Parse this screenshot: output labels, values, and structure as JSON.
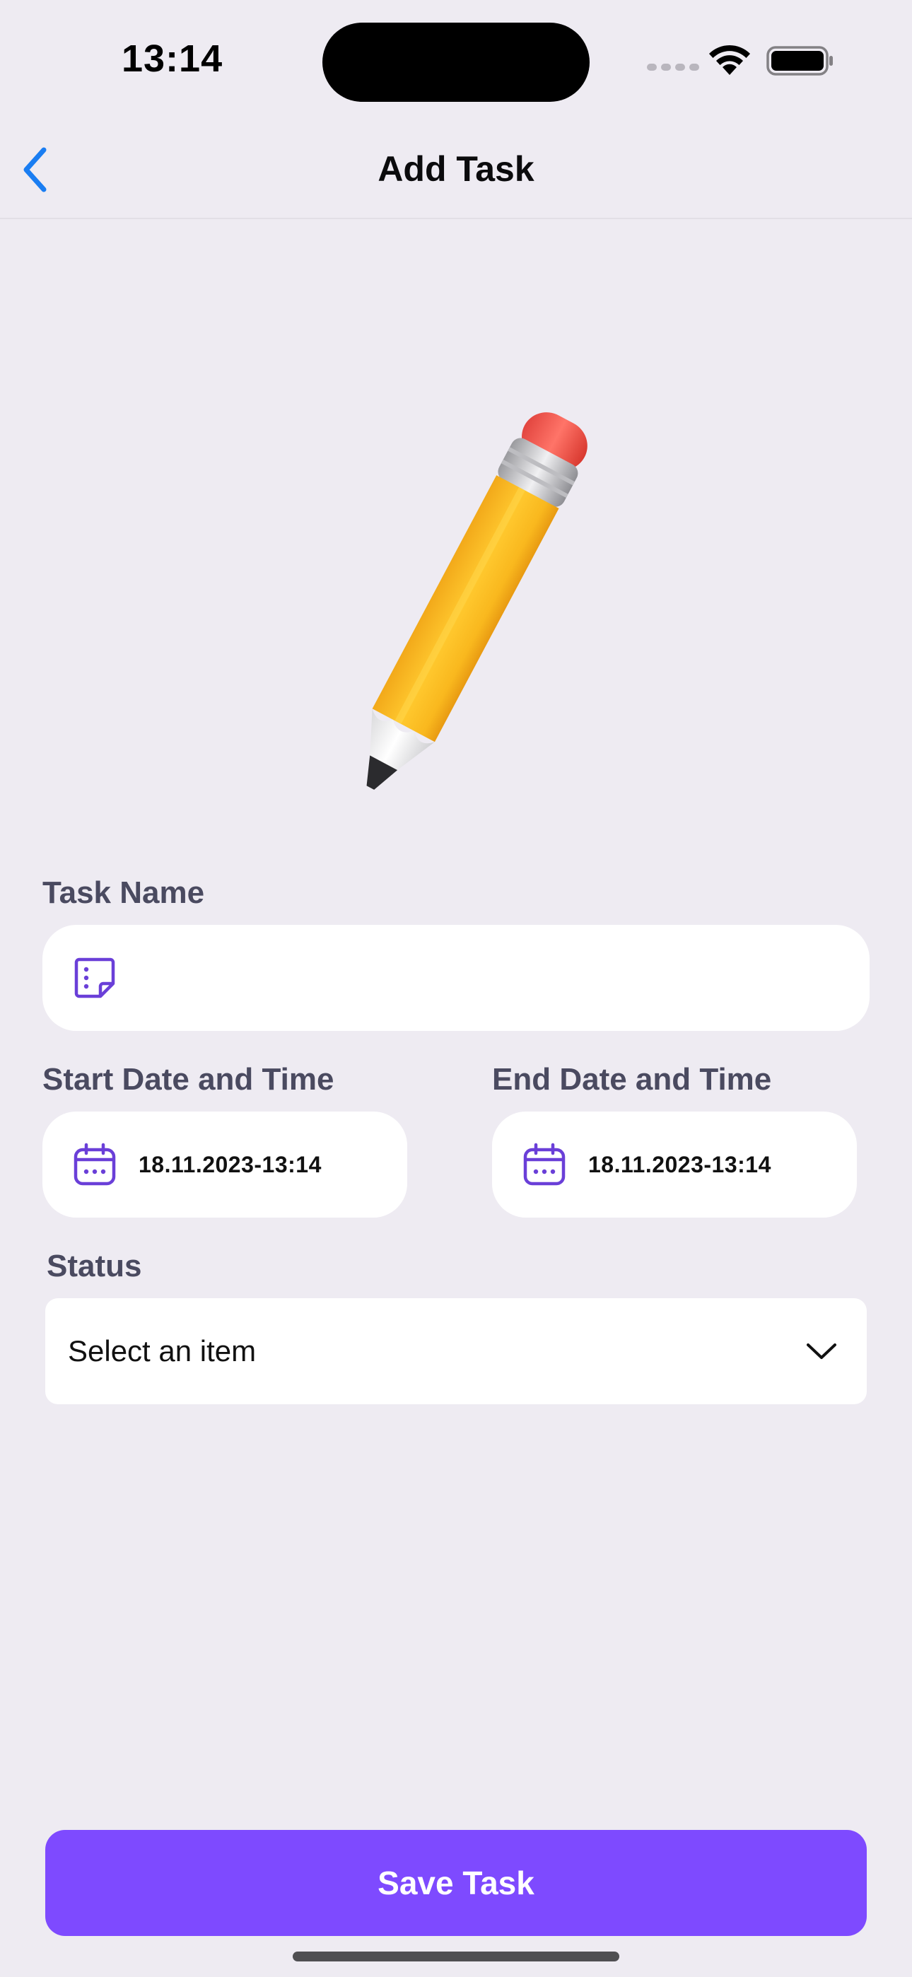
{
  "status_bar": {
    "time": "13:14"
  },
  "nav": {
    "title": "Add Task",
    "back_icon": "chevron-left-icon"
  },
  "form": {
    "task_name": {
      "label": "Task Name",
      "value": "",
      "placeholder": "",
      "icon": "note-icon"
    },
    "start": {
      "label": "Start Date and Time",
      "value": "18.11.2023-13:14",
      "icon": "calendar-icon"
    },
    "end": {
      "label": "End Date and Time",
      "value": "18.11.2023-13:14",
      "icon": "calendar-icon"
    },
    "status": {
      "label": "Status",
      "selected": "Select an item",
      "icon": "chevron-down-icon"
    }
  },
  "save_button": {
    "label": "Save Task"
  },
  "colors": {
    "background": "#EEEBF2",
    "accent": "#7E4AFF",
    "icon_purple": "#6A3FD8",
    "back_blue": "#1A7DF2",
    "label_gray": "#4A4A60"
  }
}
